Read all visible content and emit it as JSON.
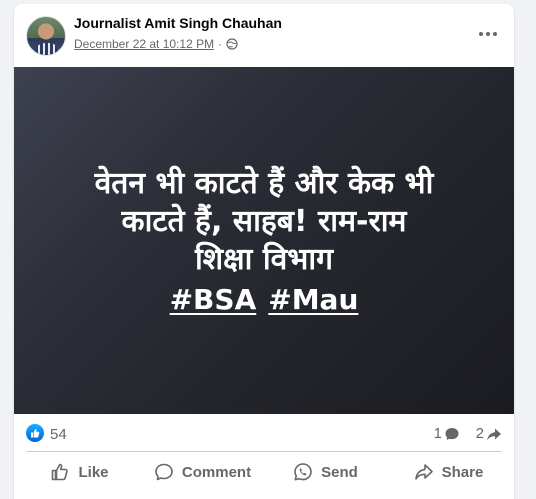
{
  "post": {
    "author": "Journalist Amit Singh Chauhan",
    "timestamp": "December 22 at 10:12 PM",
    "separator": "·",
    "privacy_icon": "globe-icon",
    "more_icon": "more-options-icon"
  },
  "image_text": {
    "line1": "वेतन भी काटते हैं और केक भी",
    "line2": "काटते हैं, साहब! राम-राम",
    "line3": "शिक्षा विभाग",
    "hashtags": [
      "#BSA",
      "#Mau"
    ]
  },
  "stats": {
    "reactions": "54",
    "comments": "1",
    "shares": "2"
  },
  "actions": {
    "like": "Like",
    "comment": "Comment",
    "send": "Send",
    "share": "Share"
  },
  "colors": {
    "like_blue": "#0866ff",
    "secondary_text": "#65676b",
    "background": "#f0f2f5"
  }
}
